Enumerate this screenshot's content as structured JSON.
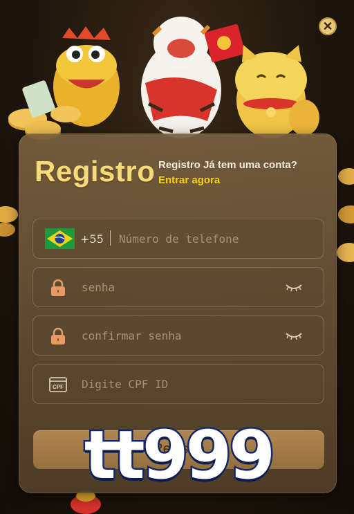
{
  "header": {
    "title": "Registro",
    "subtitle": "Registro Já tem uma conta?",
    "login_link": "Entrar agora"
  },
  "close_icon": "close-icon",
  "form": {
    "phone": {
      "country_code": "+55",
      "placeholder": "Número de telefone",
      "flag_icon": "brazil-flag-icon"
    },
    "password": {
      "placeholder": "senha",
      "icon": "lock-icon",
      "toggle_icon": "eye-closed-icon"
    },
    "confirm_password": {
      "placeholder": "confirmar senha",
      "icon": "lock-icon",
      "toggle_icon": "eye-closed-icon"
    },
    "cpf": {
      "placeholder": "Digite CPF ID",
      "icon": "cpf-card-icon",
      "icon_text": "CPF"
    },
    "submit_label": "Registro"
  },
  "watermark": "tt999",
  "colors": {
    "title": "#f7da7a",
    "link": "#f2d21a",
    "panel": "#6f5738",
    "button": "#a07a46",
    "watermark_fill": "#ffffff",
    "watermark_stroke": "#13286b"
  }
}
